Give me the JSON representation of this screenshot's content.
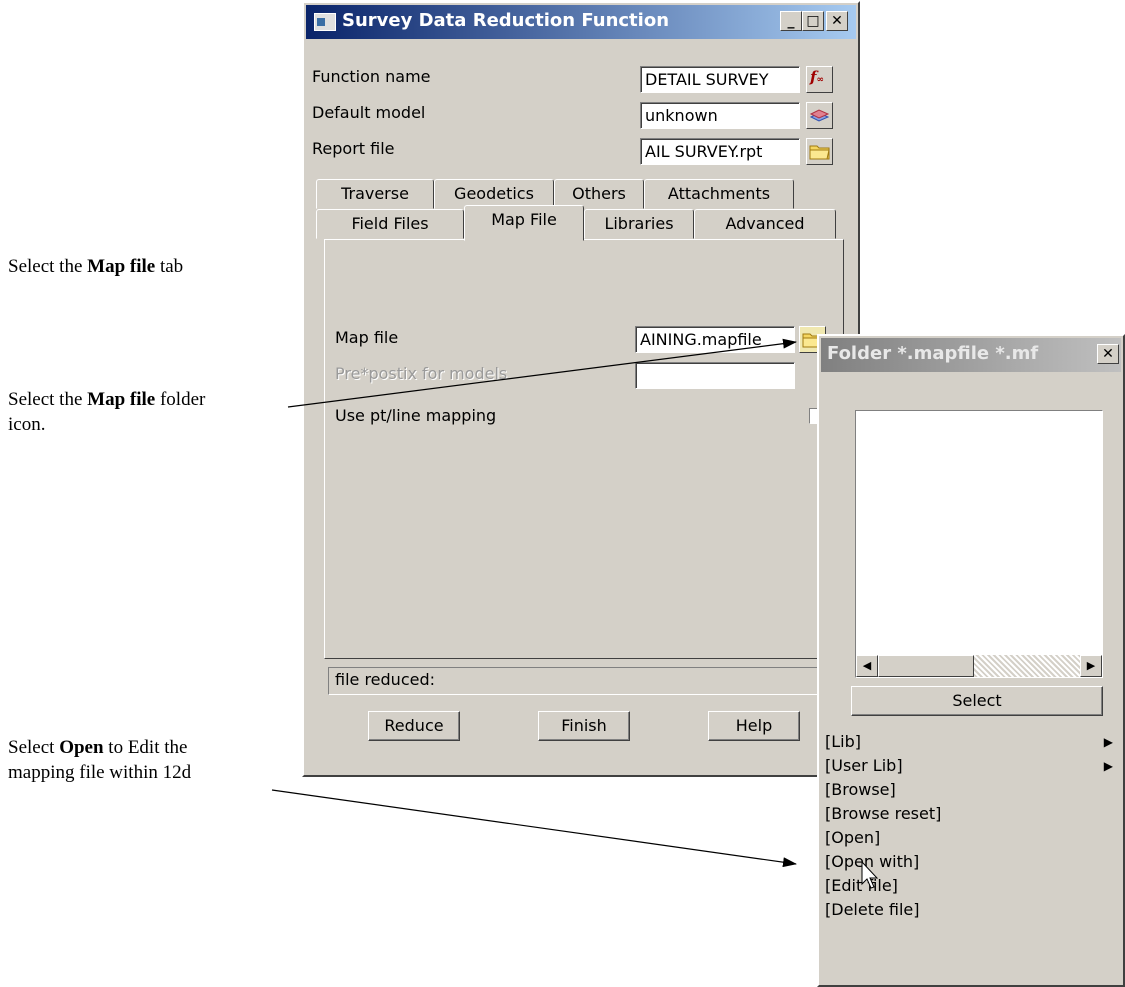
{
  "annotations": {
    "step1": {
      "pre": "Select the ",
      "bold": "Map file",
      "post": " tab"
    },
    "step2": {
      "pre": "Select the ",
      "bold": "Map file",
      "post": " folder",
      "line2": "icon."
    },
    "step3": {
      "pre": "Select ",
      "bold": "Open",
      "post": " to Edit the",
      "line2": "mapping file within 12d"
    }
  },
  "dialog": {
    "title": "Survey Data Reduction Function",
    "function_name_label": "Function name",
    "function_name_value": "DETAIL SURVEY",
    "default_model_label": "Default model",
    "default_model_value": "unknown",
    "report_file_label": "Report file",
    "report_file_value": "AIL SURVEY.rpt",
    "tabs_row1": [
      "Traverse",
      "Geodetics",
      "Others",
      "Attachments"
    ],
    "tabs_row2": [
      "Field Files",
      "Map File",
      "Libraries",
      "Advanced"
    ],
    "selected_tab": "Map File",
    "map_file_label": "Map file",
    "map_file_value": "AINING.mapfile",
    "prepostfix_label": "Pre*postix for models",
    "prepostfix_value": "",
    "use_mapping_label": "Use pt/line mapping",
    "status_text": "file reduced:",
    "buttons": {
      "reduce": "Reduce",
      "finish": "Finish",
      "help": "Help"
    }
  },
  "popup": {
    "title": "Folder *.mapfile *.mf",
    "select_label": "Select",
    "menu": [
      {
        "label": "[Lib]",
        "submenu": true
      },
      {
        "label": "[User Lib]",
        "submenu": true
      },
      {
        "label": "[Browse]",
        "submenu": false
      },
      {
        "label": "[Browse reset]",
        "submenu": false
      },
      {
        "label": "[Open]",
        "submenu": false
      },
      {
        "label": "[Open with]",
        "submenu": false
      },
      {
        "label": "[Edit file]",
        "submenu": false
      },
      {
        "label": "[Delete file]",
        "submenu": false
      }
    ]
  },
  "colors": {
    "title_active": "#0a246a",
    "title_inactive": "#808080",
    "face": "#d4d0c8"
  }
}
